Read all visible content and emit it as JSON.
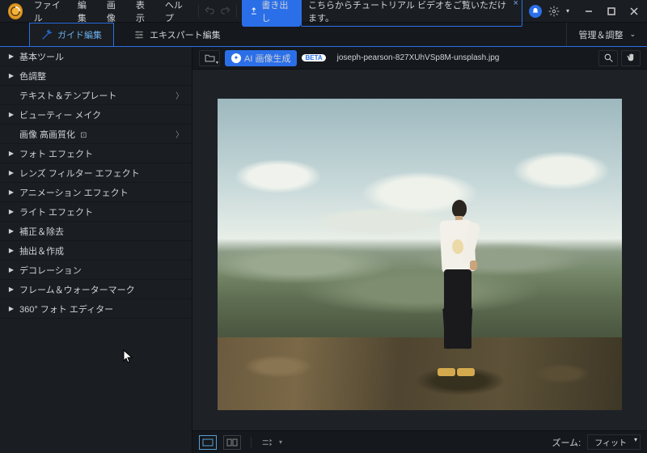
{
  "menu": {
    "file": "ファイル",
    "edit": "編集",
    "image": "画像",
    "view": "表示",
    "help": "ヘルプ"
  },
  "titlebar": {
    "export": "書き出し",
    "tutorial": "こちらからチュートリアル ビデオをご覧いただけます。"
  },
  "modebar": {
    "guide": "ガイド編集",
    "expert": "エキスパート編集",
    "manage": "管理＆調整"
  },
  "sidebar": {
    "items": [
      {
        "label": "基本ツール"
      },
      {
        "label": "色調整"
      },
      {
        "label": "テキスト＆テンプレート",
        "sub": true,
        "chev": true
      },
      {
        "label": "ビューティー メイク"
      },
      {
        "label": "画像 高画質化",
        "sub": true,
        "chev": true,
        "enhance": true
      },
      {
        "label": "フォト エフェクト"
      },
      {
        "label": "レンズ フィルター エフェクト"
      },
      {
        "label": "アニメーション エフェクト"
      },
      {
        "label": "ライト エフェクト"
      },
      {
        "label": "補正＆除去"
      },
      {
        "label": "抽出＆作成"
      },
      {
        "label": "デコレーション"
      },
      {
        "label": "フレーム＆ウォーターマーク"
      },
      {
        "label": "360° フォト エディター"
      }
    ]
  },
  "toolbar2": {
    "ai": "AI 画像生成",
    "beta": "BETA",
    "filename": "joseph-pearson-827XUhVSp8M-unsplash.jpg"
  },
  "bottombar": {
    "zoom_label": "ズーム:",
    "fit": "フィット"
  }
}
